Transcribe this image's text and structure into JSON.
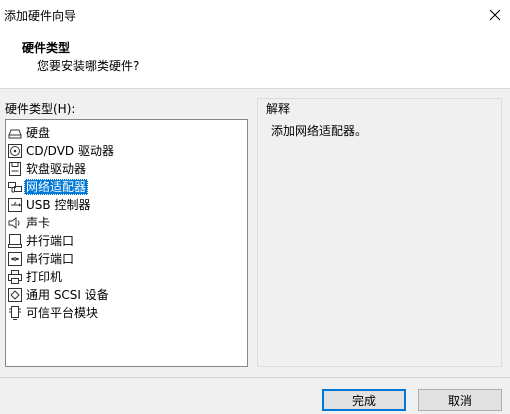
{
  "window": {
    "title": "添加硬件向导"
  },
  "header": {
    "title": "硬件类型",
    "subtitle": "您要安装哪类硬件?"
  },
  "hardware": {
    "label": "硬件类型(H):",
    "selected_index": 3,
    "items": [
      {
        "label": "硬盘",
        "icon": "hard-disk-icon"
      },
      {
        "label": "CD/DVD 驱动器",
        "icon": "cd-dvd-icon"
      },
      {
        "label": "软盘驱动器",
        "icon": "floppy-icon"
      },
      {
        "label": "网络适配器",
        "icon": "network-adapter-icon"
      },
      {
        "label": "USB 控制器",
        "icon": "usb-icon"
      },
      {
        "label": "声卡",
        "icon": "speaker-icon"
      },
      {
        "label": "并行端口",
        "icon": "parallel-port-icon"
      },
      {
        "label": "串行端口",
        "icon": "serial-port-icon"
      },
      {
        "label": "打印机",
        "icon": "printer-icon"
      },
      {
        "label": "通用 SCSI 设备",
        "icon": "scsi-icon"
      },
      {
        "label": "可信平台模块",
        "icon": "tpm-icon"
      }
    ]
  },
  "description": {
    "title": "解释",
    "text": "添加网络适配器。"
  },
  "buttons": {
    "finish": "完成",
    "cancel": "取消"
  },
  "colors": {
    "selection": "#0078d7",
    "window_bg": "#f0f0f0",
    "default_button_border": "#0078d7"
  }
}
